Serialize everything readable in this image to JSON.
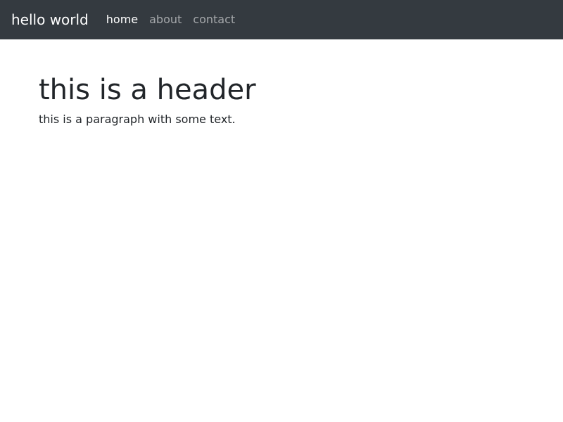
{
  "navbar": {
    "brand": "hello world",
    "links": [
      {
        "label": "home",
        "active": true
      },
      {
        "label": "about",
        "active": false
      },
      {
        "label": "contact",
        "active": false
      }
    ],
    "background_color": "#343a40"
  },
  "main": {
    "heading": "this is a header",
    "paragraph": "this is a paragraph with some text."
  }
}
